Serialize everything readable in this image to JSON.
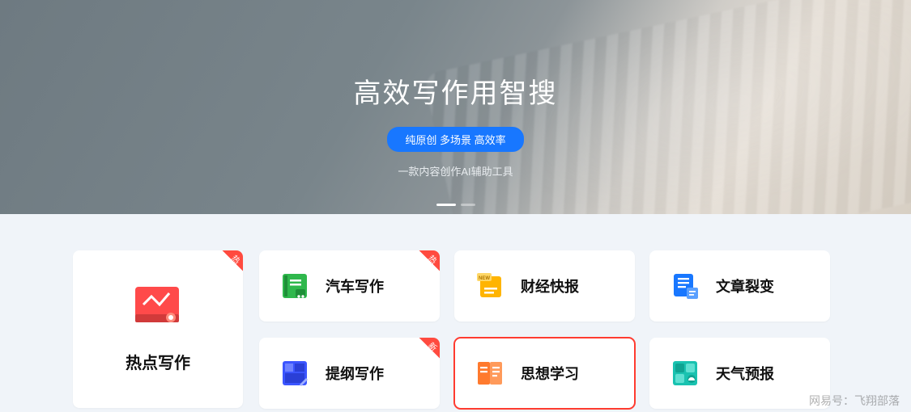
{
  "hero": {
    "title": "高效写作用智搜",
    "pill": "纯原创 多场景 高效率",
    "subtitle": "一款内容创作AI辅助工具"
  },
  "featured": {
    "label": "热点写作",
    "badge": "热",
    "icon": "monitor-chart-icon",
    "color": "#ff4a4a"
  },
  "cards": [
    {
      "label": "汽车写作",
      "badge": "热",
      "icon": "book-car-icon",
      "color": "#2fb84c"
    },
    {
      "label": "财经快报",
      "badge": "",
      "icon": "news-badge-icon",
      "color": "#ffb400"
    },
    {
      "label": "文章裂变",
      "badge": "",
      "icon": "docs-stack-icon",
      "color": "#1877ff"
    },
    {
      "label": "提纲写作",
      "badge": "新",
      "icon": "layout-edit-icon",
      "color": "#3b55ff"
    },
    {
      "label": "思想学习",
      "badge": "",
      "icon": "open-book-icon",
      "color": "#ff7a2e",
      "selected": true
    },
    {
      "label": "天气预报",
      "badge": "",
      "icon": "weather-tile-icon",
      "color": "#19c2b0"
    }
  ],
  "watermark": "网易号：飞翔部落"
}
